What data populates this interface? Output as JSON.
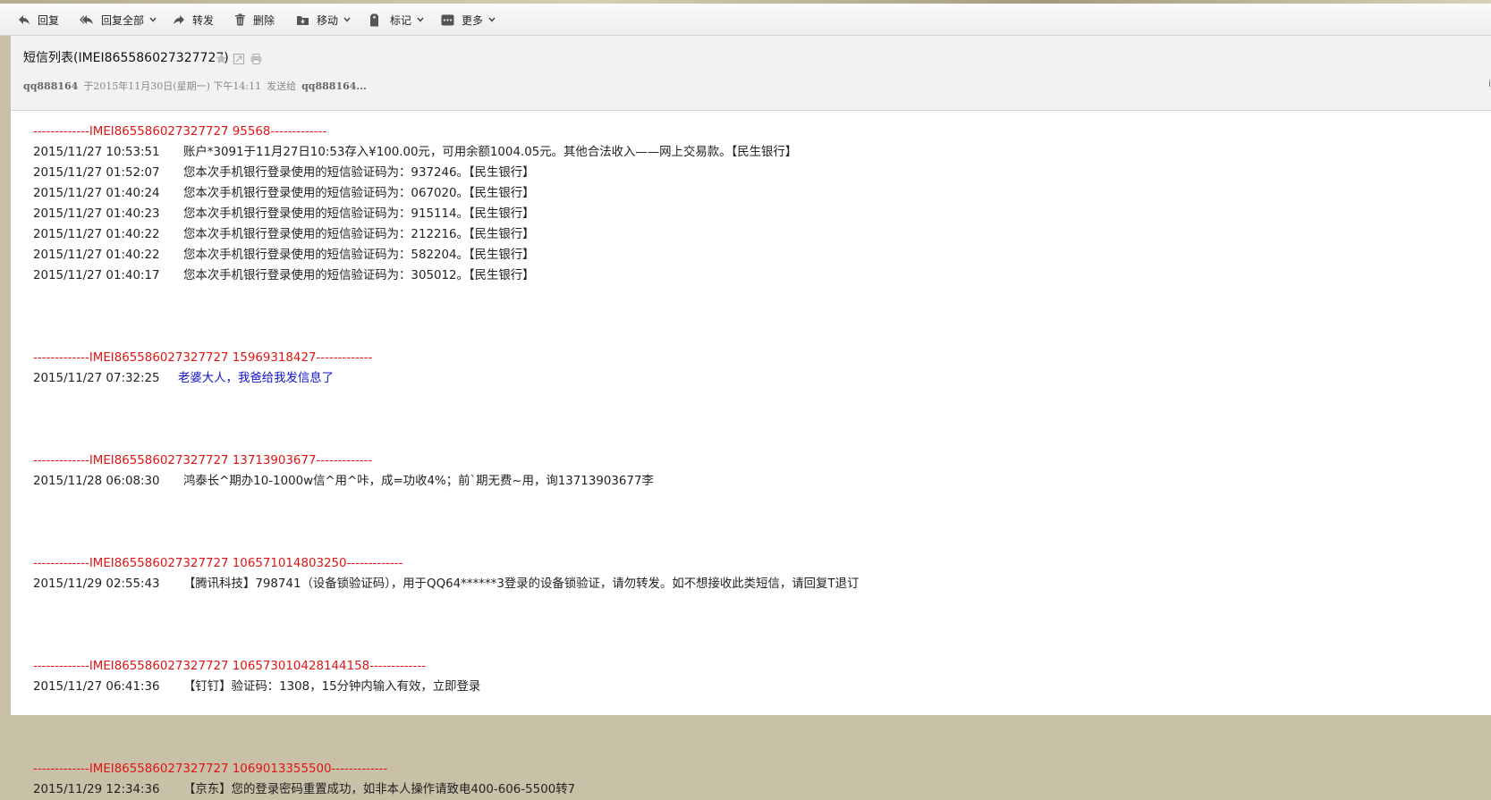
{
  "toolbar": {
    "reply": "回复",
    "reply_all": "回复全部",
    "forward": "转发",
    "delete": "删除",
    "move": "移动",
    "mark": "标记",
    "more": "更多"
  },
  "header": {
    "subject": "短信列表(IMEI865586027327727)",
    "sender": "qq888164",
    "date_text": "于2015年11月30日(星期一) 下午14:11",
    "sent_to_label": "发送给",
    "recipient": "qq888164...",
    "right_cut_char": "i"
  },
  "groups": [
    {
      "separator": "-------------IMEI865586027327727  95568-------------",
      "messages": [
        {
          "time": "2015/11/27 10:53:51",
          "text": "账户*3091于11月27日10:53存入¥100.00元，可用余额1004.05元。其他合法收入——网上交易款。【民生银行】"
        },
        {
          "time": "2015/11/27 01:52:07",
          "text": "您本次手机银行登录使用的短信验证码为：937246。【民生银行】"
        },
        {
          "time": "2015/11/27 01:40:24",
          "text": "您本次手机银行登录使用的短信验证码为：067020。【民生银行】"
        },
        {
          "time": "2015/11/27 01:40:23",
          "text": "您本次手机银行登录使用的短信验证码为：915114。【民生银行】"
        },
        {
          "time": "2015/11/27 01:40:22",
          "text": "您本次手机银行登录使用的短信验证码为：212216。【民生银行】"
        },
        {
          "time": "2015/11/27 01:40:22",
          "text": "您本次手机银行登录使用的短信验证码为：582204。【民生银行】"
        },
        {
          "time": "2015/11/27 01:40:17",
          "text": "您本次手机银行登录使用的短信验证码为：305012。【民生银行】"
        }
      ]
    },
    {
      "separator": "-------------IMEI865586027327727  15969318427-------------",
      "messages": [
        {
          "time": "2015/11/27 07:32:25",
          "text": "老婆大人，我爸给我发信息了"
        }
      ]
    },
    {
      "separator": "-------------IMEI865586027327727  13713903677-------------",
      "messages": [
        {
          "time": "2015/11/28 06:08:30",
          "text": "鸿泰长^期办10-1000w信^用^咔，成=功收4%；前`期无费~用，询13713903677李"
        }
      ]
    },
    {
      "separator": "-------------IMEI865586027327727  106571014803250-------------",
      "messages": [
        {
          "time": "2015/11/29 02:55:43",
          "text": "【腾讯科技】798741（设备锁验证码），用于QQ64******3登录的设备锁验证，请勿转发。如不想接收此类短信，请回复T退订"
        }
      ]
    },
    {
      "separator": "-------------IMEI865586027327727  106573010428144158-------------",
      "messages": [
        {
          "time": "2015/11/27 06:41:36",
          "text": "【钉钉】验证码：1308，15分钟内输入有效，立即登录"
        }
      ]
    },
    {
      "separator": "-------------IMEI865586027327727  1069013355500-------------",
      "messages": [
        {
          "time": "2015/11/29 12:34:36",
          "text": "【京东】您的登录密码重置成功，如非本人操作请致电400-606-5500转7"
        }
      ]
    }
  ],
  "colors": {
    "separator": "#e01414",
    "highlight_text": "#1212cc",
    "body_text": "#222222"
  }
}
